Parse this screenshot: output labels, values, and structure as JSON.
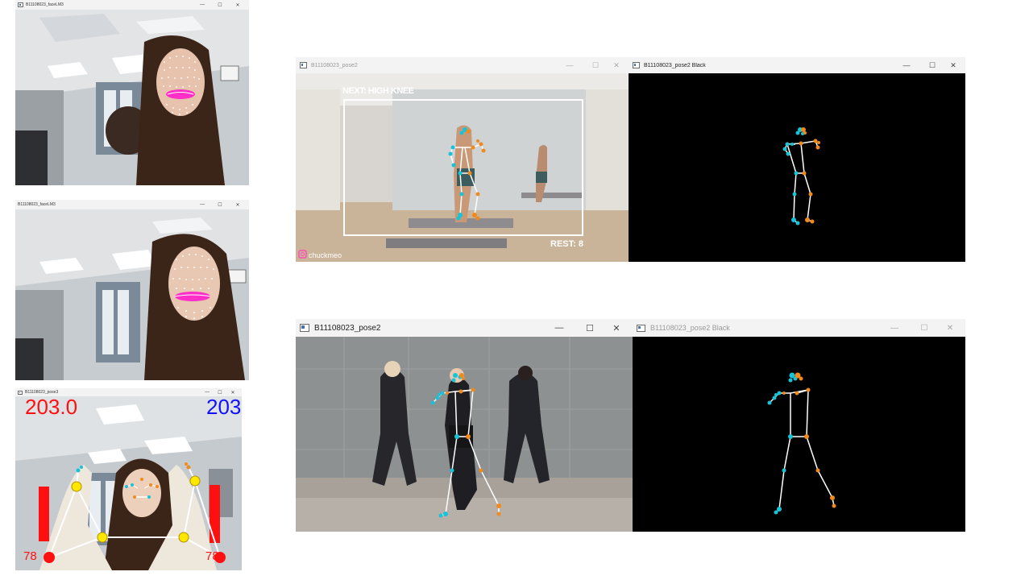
{
  "windows": {
    "face1": {
      "title": "B11108023_faceLM3"
    },
    "face2": {
      "title": "B11108023_faceLM3"
    },
    "pose3": {
      "title": "B11108023_pose3",
      "count_left": "203.0",
      "count_right": "203",
      "angle_left": "78",
      "angle_right": "78"
    },
    "pose2_top": {
      "title": "B11108023_pose2",
      "next_label": "NEXT: HIGH KNEE",
      "rest_label": "REST: 8",
      "watermark": "chuckmeo"
    },
    "pose2_top_black": {
      "title": "B11108023_pose2 Black"
    },
    "pose2_bottom": {
      "title": "B11108023_pose2"
    },
    "pose2_bottom_black": {
      "title": "B11108023_pose2 Black"
    }
  },
  "controls": {
    "minimize": "—",
    "maximize": "☐",
    "close": "✕"
  },
  "colors": {
    "cyan_joint": "#17c3d8",
    "orange_joint": "#f08a1c",
    "lip": "#ff2fc8",
    "counter_left": "#ff0000",
    "counter_right": "#0000ff"
  }
}
